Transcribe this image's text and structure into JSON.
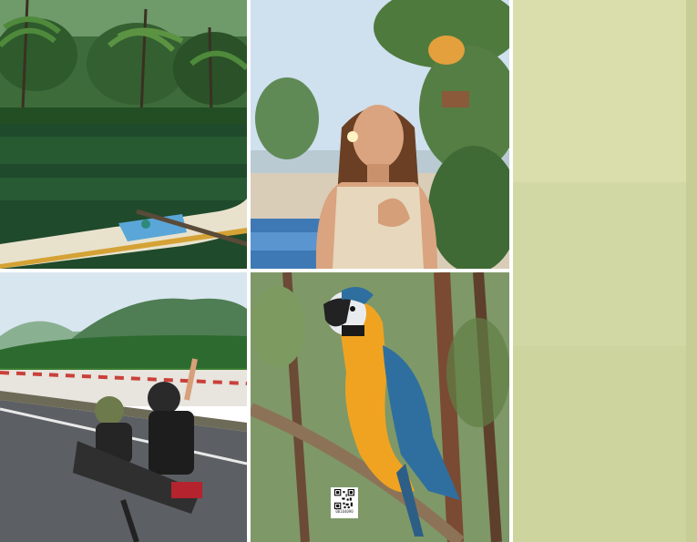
{
  "gallery": {
    "tiles": [
      {
        "id": "river",
        "alt": ""
      },
      {
        "id": "woman",
        "alt": ""
      },
      {
        "id": "road",
        "alt": ""
      },
      {
        "id": "parrot",
        "alt": ""
      },
      {
        "id": "paper",
        "alt": ""
      }
    ],
    "qr_caption": "00164090"
  },
  "colors": {
    "paper": "#d2d8a3",
    "water": "#1f4a2b",
    "sky": "#cfe0ee",
    "parrot_blue": "#2f6f9f",
    "parrot_yellow": "#f0a321"
  }
}
